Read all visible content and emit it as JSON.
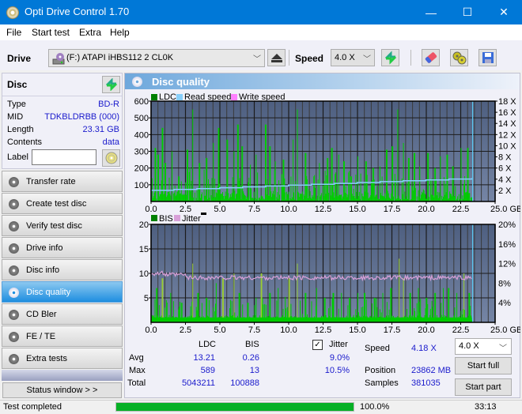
{
  "window": {
    "title": "Opti Drive Control 1.70",
    "minimize": "—",
    "maximize": "☐",
    "close": "✕"
  },
  "menu": [
    "File",
    "Start test",
    "Extra",
    "Help"
  ],
  "toolbar": {
    "drive_label": "Drive",
    "drive_value": "(F:)  ATAPI iHBS112  2 CL0K",
    "speed_label": "Speed",
    "speed_value": "4.0 X",
    "icons": [
      "eject-icon",
      "refresh-icon",
      "erase-icon",
      "settings-icon",
      "save-icon"
    ]
  },
  "disc": {
    "header": "Disc",
    "type_label": "Type",
    "type_value": "BD-R",
    "mid_label": "MID",
    "mid_value": "TDKBLDRBB (000)",
    "length_label": "Length",
    "length_value": "23.31 GB",
    "contents_label": "Contents",
    "contents_value": "data",
    "label_label": "Label",
    "label_value": ""
  },
  "nav": [
    {
      "label": "Transfer rate",
      "active": false
    },
    {
      "label": "Create test disc",
      "active": false
    },
    {
      "label": "Verify test disc",
      "active": false
    },
    {
      "label": "Drive info",
      "active": false
    },
    {
      "label": "Disc info",
      "active": false
    },
    {
      "label": "Disc quality",
      "active": true
    },
    {
      "label": "CD Bler",
      "active": false
    },
    {
      "label": "FE / TE",
      "active": false
    },
    {
      "label": "Extra tests",
      "active": false
    }
  ],
  "status_window_button": "Status window > >",
  "panel_title": "Disc quality",
  "chart_data": [
    {
      "type": "bar",
      "title": "LDC",
      "legend": [
        "LDC",
        "Read speed",
        "Write speed"
      ],
      "legend_colors": [
        "#008000",
        "#87cefa",
        "#ff80ff"
      ],
      "xlabel": "GB",
      "x_ticks": [
        "0.0",
        "2.5",
        "5.0",
        "7.5",
        "10.0",
        "12.5",
        "15.0",
        "17.5",
        "20.0",
        "22.5",
        "25.0 GB"
      ],
      "xlim": [
        0,
        25
      ],
      "ylim": [
        0,
        600
      ],
      "y_ticks": [
        "100",
        "200",
        "300",
        "400",
        "500",
        "600"
      ],
      "y2lim": [
        0,
        18
      ],
      "y2_ticks": [
        "2 X",
        "4 X",
        "6 X",
        "8 X",
        "10 X",
        "12 X",
        "14 X",
        "16 X",
        "18 X"
      ],
      "ldc_peaks": [
        [
          0.3,
          320
        ],
        [
          0.5,
          280
        ],
        [
          0.8,
          440
        ],
        [
          1.0,
          230
        ],
        [
          1.5,
          300
        ],
        [
          2.0,
          150
        ],
        [
          2.6,
          310
        ],
        [
          3.0,
          550
        ],
        [
          3.5,
          230
        ],
        [
          4.0,
          260
        ],
        [
          4.5,
          350
        ],
        [
          4.9,
          440
        ],
        [
          5.5,
          370
        ],
        [
          6.0,
          300
        ],
        [
          6.3,
          460
        ],
        [
          6.6,
          330
        ],
        [
          7.2,
          220
        ],
        [
          7.6,
          280
        ],
        [
          8.3,
          460
        ],
        [
          8.6,
          330
        ],
        [
          9.0,
          240
        ],
        [
          9.6,
          250
        ],
        [
          10.3,
          370
        ],
        [
          10.6,
          550
        ],
        [
          11.2,
          290
        ],
        [
          11.8,
          150
        ],
        [
          12.2,
          230
        ],
        [
          12.8,
          260
        ],
        [
          13.1,
          320
        ],
        [
          13.6,
          280
        ],
        [
          14.0,
          240
        ],
        [
          14.5,
          150
        ],
        [
          15.0,
          270
        ],
        [
          15.6,
          240
        ],
        [
          16.1,
          200
        ],
        [
          16.6,
          210
        ],
        [
          17.1,
          310
        ],
        [
          17.5,
          330
        ],
        [
          17.9,
          550
        ],
        [
          18.3,
          350
        ],
        [
          18.7,
          260
        ],
        [
          19.1,
          290
        ],
        [
          19.5,
          210
        ],
        [
          20.1,
          290
        ],
        [
          20.6,
          200
        ],
        [
          21.0,
          270
        ],
        [
          21.5,
          280
        ],
        [
          21.9,
          210
        ],
        [
          22.5,
          320
        ],
        [
          23.0,
          320
        ]
      ],
      "read_speed_start": 2.0,
      "read_speed_end": 4.18,
      "end_gb": 23.31
    },
    {
      "type": "bar",
      "title": "BIS",
      "legend": [
        "BIS",
        "Jitter"
      ],
      "legend_colors": [
        "#008000",
        "#d8a0d8"
      ],
      "xlabel": "GB",
      "x_ticks": [
        "0.0",
        "2.5",
        "5.0",
        "7.5",
        "10.0",
        "12.5",
        "15.0",
        "17.5",
        "20.0",
        "22.5",
        "25.0 GB"
      ],
      "xlim": [
        0,
        25
      ],
      "ylim": [
        0,
        20
      ],
      "y_ticks": [
        "5",
        "10",
        "15",
        "20"
      ],
      "y2lim": [
        0,
        20
      ],
      "y2_ticks": [
        "4%",
        "8%",
        "12%",
        "16%",
        "20%"
      ],
      "bis_peaks": [
        [
          0.4,
          7
        ],
        [
          0.8,
          9
        ],
        [
          1.4,
          6
        ],
        [
          2.2,
          4
        ],
        [
          3.0,
          12
        ],
        [
          3.4,
          6
        ],
        [
          4.0,
          5
        ],
        [
          4.7,
          8
        ],
        [
          5.2,
          9
        ],
        [
          6.0,
          10
        ],
        [
          6.4,
          6
        ],
        [
          7.0,
          4
        ],
        [
          7.6,
          5
        ],
        [
          8.0,
          10
        ],
        [
          8.6,
          6
        ],
        [
          9.2,
          7
        ],
        [
          10.0,
          9
        ],
        [
          10.6,
          12
        ],
        [
          11.2,
          6
        ],
        [
          12.0,
          7
        ],
        [
          12.6,
          5
        ],
        [
          13.2,
          6
        ],
        [
          13.8,
          6
        ],
        [
          14.4,
          5
        ],
        [
          15.0,
          6
        ],
        [
          15.5,
          6
        ],
        [
          16.2,
          5
        ],
        [
          16.8,
          6
        ],
        [
          17.4,
          7
        ],
        [
          18.0,
          13
        ],
        [
          18.3,
          9
        ],
        [
          18.8,
          6
        ],
        [
          19.4,
          7
        ],
        [
          20.0,
          5
        ],
        [
          20.6,
          6
        ],
        [
          21.2,
          7
        ],
        [
          21.6,
          7
        ],
        [
          22.2,
          6
        ],
        [
          22.7,
          10
        ],
        [
          23.1,
          6
        ]
      ],
      "jitter_avg_pct": 9.0
    }
  ],
  "stats": {
    "col_ldc": "LDC",
    "col_bis": "BIS",
    "avg_label": "Avg",
    "avg_ldc": "13.21",
    "avg_bis": "0.26",
    "max_label": "Max",
    "max_ldc": "589",
    "max_bis": "13",
    "total_label": "Total",
    "total_ldc": "5043211",
    "total_bis": "100888",
    "jitter_label": "Jitter",
    "jitter_checked": true,
    "jitter_avg": "9.0%",
    "jitter_max": "10.5%",
    "speed_label": "Speed",
    "speed_value": "4.18 X",
    "position_label": "Position",
    "position_value": "23862 MB",
    "samples_label": "Samples",
    "samples_value": "381035",
    "speed_select": "4.0 X",
    "start_full": "Start full",
    "start_part": "Start part"
  },
  "statusbar": {
    "text": "Test completed",
    "progress_pct": 100.0,
    "progress_text": "100.0%",
    "time": "33:13"
  }
}
